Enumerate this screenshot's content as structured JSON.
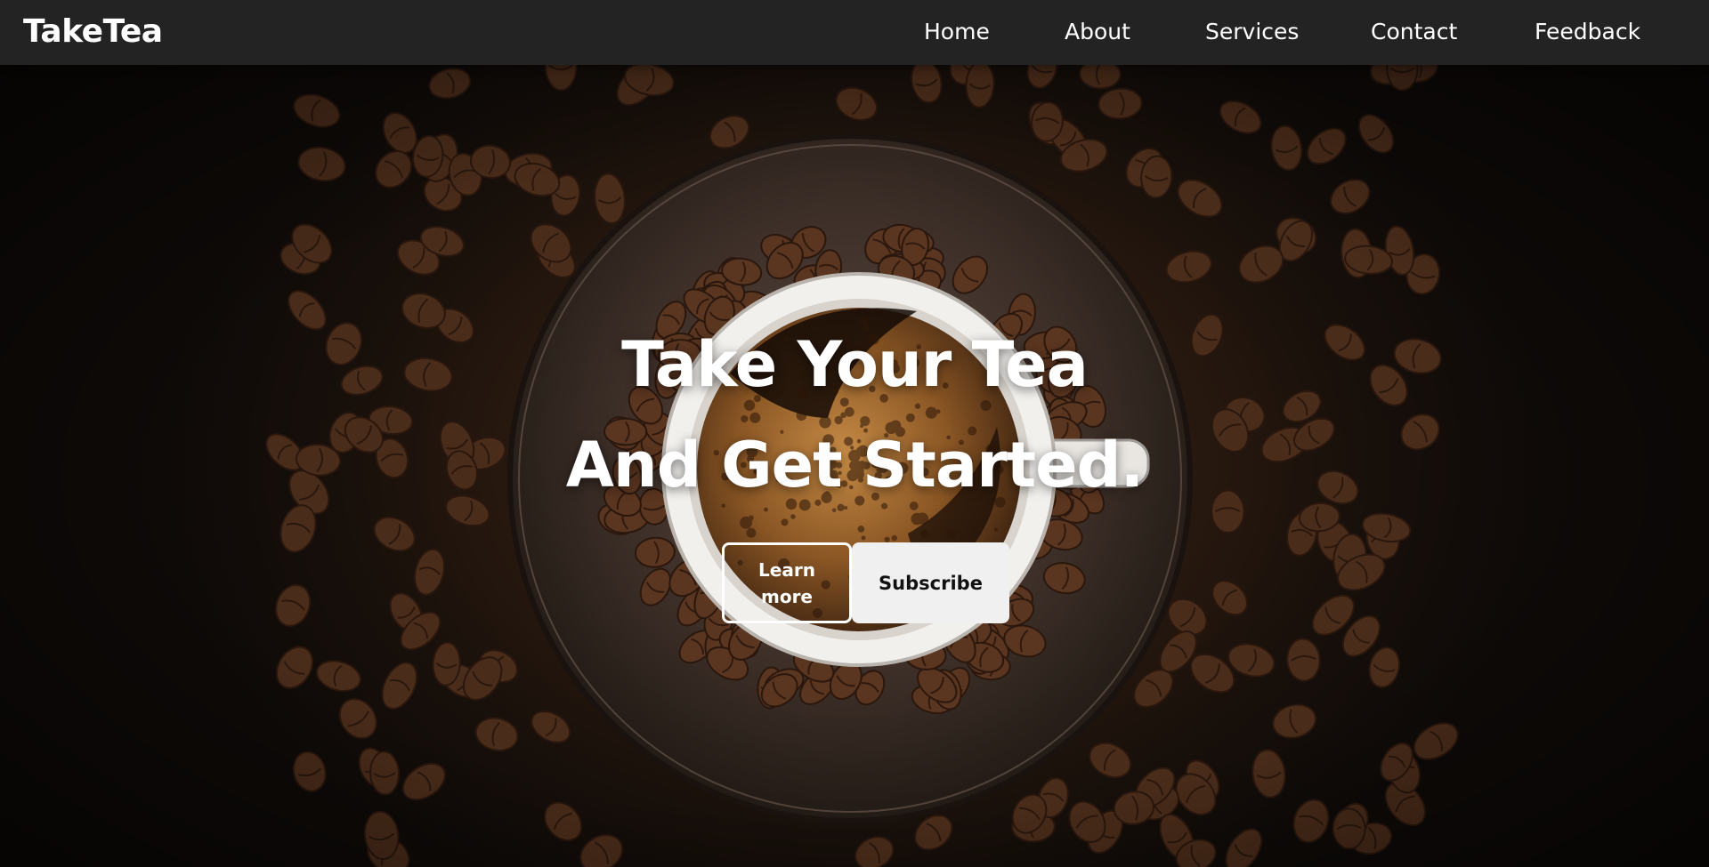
{
  "brand": {
    "logo_text": "TakeTea"
  },
  "nav": {
    "items": [
      {
        "label": "Home"
      },
      {
        "label": "About"
      },
      {
        "label": "Services"
      },
      {
        "label": "Contact"
      },
      {
        "label": "Feedback"
      }
    ]
  },
  "hero": {
    "headline_line1": "Take Your Tea",
    "headline_line2": "And Get Started.",
    "primary_button": "Learn more",
    "secondary_button": "Subscribe",
    "background_image": "coffee-cup-and-beans-photo"
  },
  "colors": {
    "navbar_bg": "#232323",
    "text": "#ffffff",
    "subscribe_bg": "#f0f0f0",
    "coffee_dark": "#2a1a10"
  }
}
